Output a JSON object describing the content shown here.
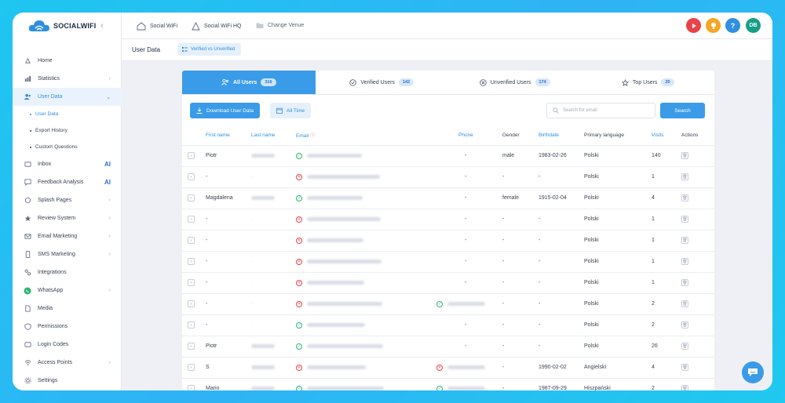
{
  "brand": "SOCIALWIFI",
  "sidebar": {
    "items": [
      {
        "label": "Home",
        "icon": "rocket-icon",
        "chevron": false
      },
      {
        "label": "Statistics",
        "icon": "bar-chart-icon",
        "chevron": true
      },
      {
        "label": "User Data",
        "icon": "users-icon",
        "chevron": true,
        "active": true
      },
      {
        "label": "Inbox",
        "icon": "inbox-icon",
        "ai": "AI"
      },
      {
        "label": "Feedback Analysis",
        "icon": "feedback-icon",
        "ai": "AI"
      },
      {
        "label": "Splash Pages",
        "icon": "splash-icon",
        "chevron": true
      },
      {
        "label": "Review System",
        "icon": "review-icon",
        "chevron": true
      },
      {
        "label": "Email Marketing",
        "icon": "mail-icon",
        "chevron": true
      },
      {
        "label": "SMS Marketing",
        "icon": "sms-icon",
        "chevron": true
      },
      {
        "label": "Integrations",
        "icon": "integrations-icon"
      },
      {
        "label": "WhatsApp",
        "icon": "whatsapp-icon",
        "chevron": true
      },
      {
        "label": "Media",
        "icon": "media-icon"
      },
      {
        "label": "Permissions",
        "icon": "shield-icon"
      },
      {
        "label": "Login Codes",
        "icon": "code-icon"
      },
      {
        "label": "Access Points",
        "icon": "wifi-icon",
        "chevron": true
      },
      {
        "label": "Settings",
        "icon": "settings-icon"
      }
    ],
    "sub": [
      "User Data",
      "Export History",
      "Custom Questions"
    ]
  },
  "topbar": {
    "crumb1": "Social WiFi",
    "crumb2": "Social WiFi HQ",
    "crumb3": "Change Venue",
    "avatar": "DB",
    "help": "?"
  },
  "page": {
    "title": "User Data",
    "pill": "Verified vs Unverified"
  },
  "tabs": [
    {
      "label": "All Users",
      "count": "316"
    },
    {
      "label": "Verified Users",
      "count": "142"
    },
    {
      "label": "Unverified Users",
      "count": "174"
    },
    {
      "label": "Top Users",
      "count": "20"
    }
  ],
  "toolbar": {
    "download": "Download User Data",
    "range": "All Time",
    "search_placeholder": "Search for email",
    "search": "Search"
  },
  "columns": [
    "First name",
    "Last name",
    "Email",
    "Phone",
    "Gender",
    "Birthdate",
    "Primary language",
    "Visits",
    "Actions"
  ],
  "rows": [
    {
      "first": "Piotr",
      "last": true,
      "email_ok": true,
      "phone": "-",
      "phone_status": null,
      "gender": "male",
      "birth": "1983-02-26",
      "lang": "Polski",
      "visits": "140"
    },
    {
      "first": "-",
      "last": false,
      "email_ok": false,
      "phone": "-",
      "phone_status": null,
      "gender": "-",
      "birth": "-",
      "lang": "Polski",
      "visits": "1"
    },
    {
      "first": "Magdalena",
      "last": true,
      "email_ok": true,
      "phone": "-",
      "phone_status": null,
      "gender": "female",
      "birth": "1915-02-04",
      "lang": "Polski",
      "visits": "4"
    },
    {
      "first": "-",
      "last": false,
      "email_ok": false,
      "phone": "-",
      "phone_status": null,
      "gender": "-",
      "birth": "-",
      "lang": "Polski",
      "visits": "1"
    },
    {
      "first": "-",
      "last": false,
      "email_ok": false,
      "phone": "-",
      "phone_status": null,
      "gender": "-",
      "birth": "-",
      "lang": "Polski",
      "visits": "1"
    },
    {
      "first": "-",
      "last": false,
      "email_ok": false,
      "phone": "-",
      "phone_status": null,
      "gender": "-",
      "birth": "-",
      "lang": "Polski",
      "visits": "1"
    },
    {
      "first": "-",
      "last": false,
      "email_ok": false,
      "phone": "-",
      "phone_status": null,
      "gender": "-",
      "birth": "-",
      "lang": "Polski",
      "visits": "1"
    },
    {
      "first": "-",
      "last": false,
      "email_ok": false,
      "phone": "",
      "phone_status": "ok",
      "gender": "-",
      "birth": "-",
      "lang": "Polski",
      "visits": "2"
    },
    {
      "first": "-",
      "last": false,
      "email_ok": true,
      "phone": "-",
      "phone_status": null,
      "gender": "-",
      "birth": "-",
      "lang": "Polski",
      "visits": "2"
    },
    {
      "first": "Piotr",
      "last": true,
      "email_ok": true,
      "phone": "-",
      "phone_status": null,
      "gender": "-",
      "birth": "-",
      "lang": "Polski",
      "visits": "26"
    },
    {
      "first": "S",
      "last": true,
      "email_ok": false,
      "phone": "",
      "phone_status": "bad",
      "gender": "-",
      "birth": "1990-02-02",
      "lang": "Angielski",
      "visits": "4"
    },
    {
      "first": "Mario",
      "last": true,
      "email_ok": true,
      "phone": "",
      "phone_status": "ok",
      "gender": "-",
      "birth": "1987-09-29",
      "lang": "Hiszpański",
      "visits": "2"
    }
  ],
  "colors": {
    "accent": "#3a9be8",
    "ok": "#2bb673",
    "bad": "#e9434a"
  }
}
